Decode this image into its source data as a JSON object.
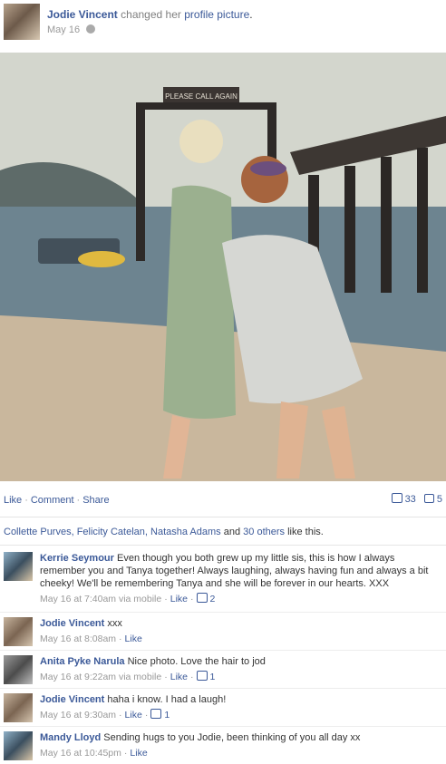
{
  "post": {
    "author": "Jodie Vincent",
    "action_text": "changed her",
    "action_link": "profile picture",
    "period": ".",
    "date": "May 16"
  },
  "actions": {
    "like": "Like",
    "comment": "Comment",
    "share": "Share",
    "like_count": "33",
    "comment_count": "5",
    "separator": "·"
  },
  "likes_line": {
    "names": "Collette Purves, Felicity Catelan, Natasha Adams",
    "and": "and",
    "others": "30 others",
    "suffix": "like this."
  },
  "comments": [
    {
      "author": "Kerrie Seymour",
      "text": "Even though you both grew up my little sis, this is how I always remember you and Tanya together! Always laughing, always having fun and always a bit cheeky! We'll be remembering Tanya and she will be forever in our hearts. XXX",
      "time": "May 16 at 7:40am via mobile",
      "like_label": "Like",
      "like_count": "2"
    },
    {
      "author": "Jodie Vincent",
      "text": "xxx",
      "time": "May 16 at 8:08am",
      "like_label": "Like",
      "like_count": ""
    },
    {
      "author": "Anita Pyke Narula",
      "text": "Nice photo. Love the hair to jod",
      "time": "May 16 at 9:22am via mobile",
      "like_label": "Like",
      "like_count": "1"
    },
    {
      "author": "Jodie Vincent",
      "text": "haha i know. I had a laugh!",
      "time": "May 16 at 9:30am",
      "like_label": "Like",
      "like_count": "1"
    },
    {
      "author": "Mandy Lloyd",
      "text": "Sending hugs to you Jodie, been thinking of you all day xx",
      "time": "May 16 at 10:45pm",
      "like_label": "Like",
      "like_count": ""
    }
  ],
  "photo": {
    "sign_text": "PLEASE CALL AGAIN"
  }
}
